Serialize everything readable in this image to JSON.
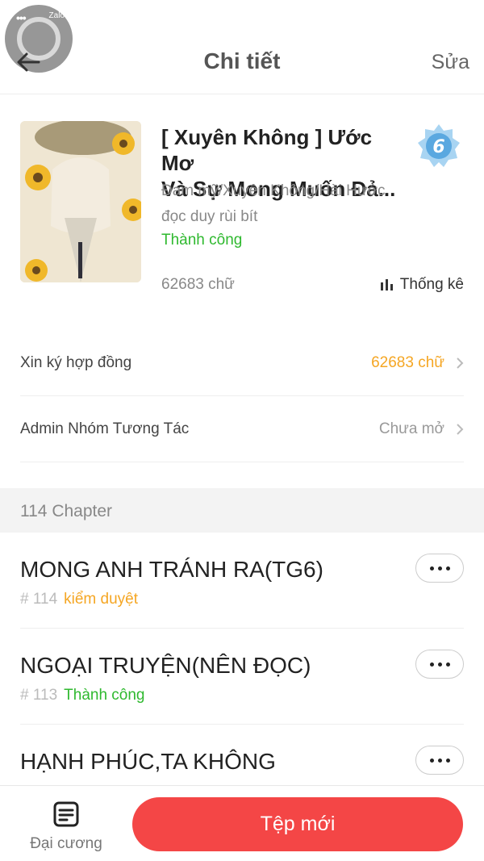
{
  "header": {
    "title": "Chi tiết",
    "edit_label": "Sửa",
    "bubble_label": "Zalo"
  },
  "book": {
    "title_line1": "[ Xuyên Không ] Ước Mơ",
    "title_line2": "Và Sự Mong Muốn Đả...",
    "level": "6",
    "genres": "Đam mỹ/Xuyên Không/Hài Hước",
    "description": "đọc duy rùi bít",
    "status": "Thành công",
    "word_count": "62683 chữ",
    "stats_label": "Thống kê"
  },
  "rows": [
    {
      "label": "Xin ký hợp đồng",
      "value": "62683 chữ",
      "value_color": "#f5a623"
    },
    {
      "label": "Admin Nhóm Tương Tác",
      "value": "Chưa mở",
      "value_color": "#999999"
    }
  ],
  "chapters_header": "114 Chapter",
  "chapters": [
    {
      "title": "MONG ANH TRÁNH RA(TG6)",
      "number": "# 114",
      "status": "kiểm duyệt",
      "status_color": "#f5a623"
    },
    {
      "title": "NGOẠI TRUYỆN(NÊN ĐỌC)",
      "number": "# 113",
      "status": "Thành công",
      "status_color": "#2fb92f"
    },
    {
      "title": "HẠNH PHÚC,TA KHÔNG",
      "number": "",
      "status": "",
      "status_color": "#2fb92f"
    }
  ],
  "bottom": {
    "outline_label": "Đại cương",
    "new_file_label": "Tệp mới"
  },
  "colors": {
    "accent": "#f44646",
    "success": "#2fb92f",
    "warning": "#f5a623"
  }
}
